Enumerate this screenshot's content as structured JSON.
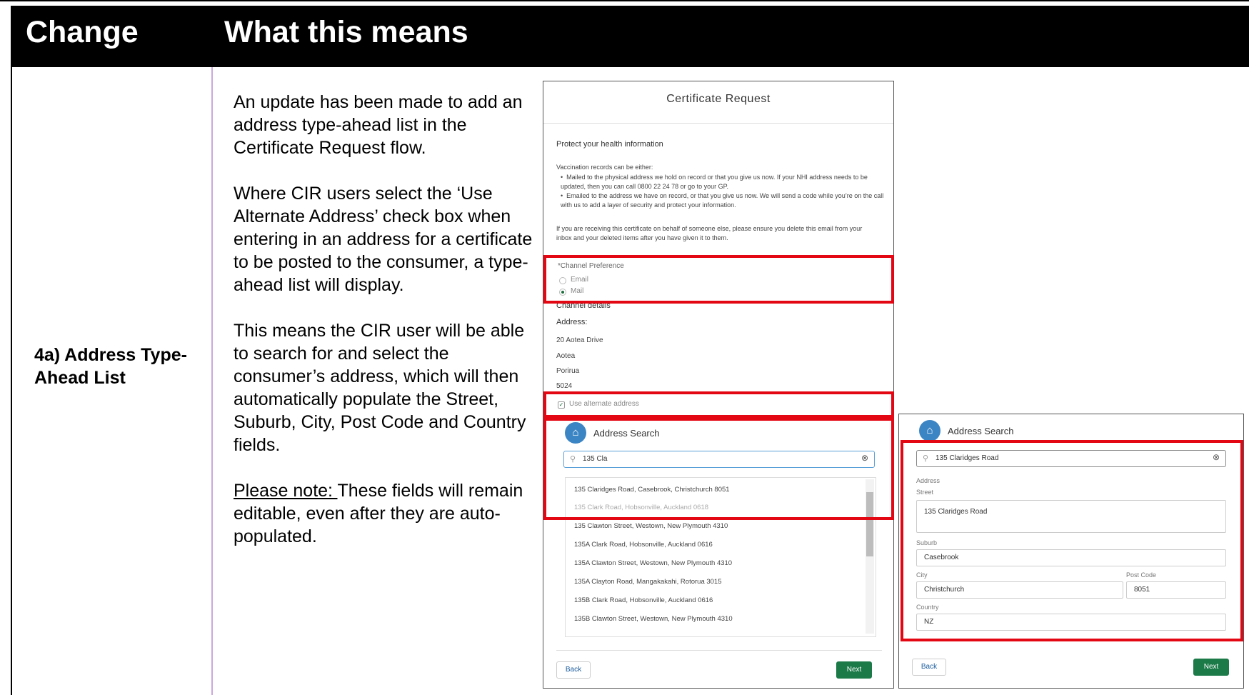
{
  "header": {
    "change": "Change",
    "means": "What this means"
  },
  "change_label": "4a) Address Type-Ahead List",
  "body": {
    "p1": "An update has been made to add an address type-ahead list in the Certificate Request flow.",
    "p2": "Where CIR users select the ‘Use Alternate Address’ check box when entering in an address for a certificate to be posted to the consumer, a type-ahead list will display.",
    "p3": "This means the CIR user will be able to search for and select the consumer’s address, which will then automatically populate the Street, Suburb, City, Post Code and Country fields.",
    "note_label": "Please note: ",
    "note_text": "These fields will remain editable, even after they are auto-populated."
  },
  "screen1": {
    "title": "Certificate Request",
    "protect_heading": "Protect your health information",
    "records_intro": "Vaccination records can be either:",
    "bullet1": "Mailed to the physical address we hold on record or that you give us now. If your NHI address needs to be updated, then you can call 0800 22 24 78 or go to your GP.",
    "bullet2": "Emailed to the address we have on record, or that you give us now. We will send a code while you’re on the call with us to add a layer of security and protect your information.",
    "behalf_note": "If you are receiving this certificate on behalf of someone else, please ensure you delete this email from your inbox and your deleted items after you have given it to them.",
    "channel_pref": "*Channel Preference",
    "opt_email": "Email",
    "opt_mail": "Mail",
    "channel_details": "Channel details",
    "address_label": "Address:",
    "addr_line1": "20 Aotea Drive",
    "addr_line2": "Aotea",
    "addr_line3": "Porirua",
    "addr_line4": "5024",
    "use_alt": "Use alternate address",
    "search_title": "Address Search",
    "search_value": "135 Cla",
    "results": [
      "135 Claridges Road, Casebrook, Christchurch 8051",
      "135 Clark Road, Hobsonville, Auckland 0618",
      "135 Clawton Street, Westown, New Plymouth 4310",
      "135A Clark Road, Hobsonville, Auckland 0616",
      "135A Clawton Street, Westown, New Plymouth 4310",
      "135A Clayton Road, Mangakakahi, Rotorua 3015",
      "135B Clark Road, Hobsonville, Auckland 0616",
      "135B Clawton Street, Westown, New Plymouth 4310"
    ],
    "back": "Back",
    "next": "Next"
  },
  "screen2": {
    "search_title": "Address Search",
    "search_value": "135 Claridges Road",
    "address_label": "Address",
    "street_label": "Street",
    "street_value": "135 Claridges Road",
    "suburb_label": "Suburb",
    "suburb_value": "Casebrook",
    "city_label": "City",
    "city_value": "Christchurch",
    "post_label": "Post Code",
    "post_value": "8051",
    "country_label": "Country",
    "country_value": "NZ",
    "back": "Back",
    "next": "Next"
  },
  "colors": {
    "highlight": "#e30613",
    "next_button": "#1b7a48",
    "column_divider": "#c9a8dc"
  }
}
